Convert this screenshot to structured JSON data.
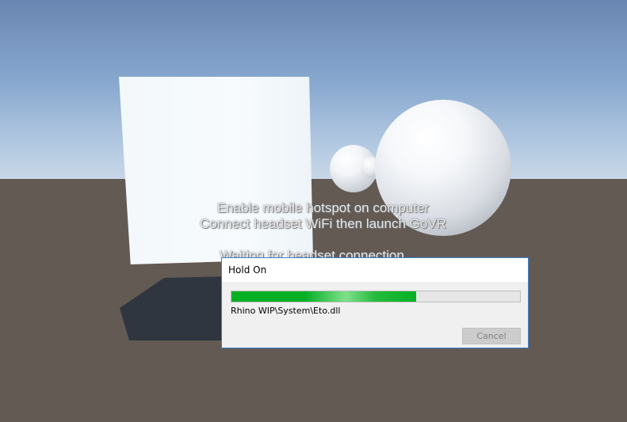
{
  "scene": {
    "instructions": [
      "Enable mobile hotspot on computer",
      "Connect headset WiFi then launch GoVR"
    ],
    "status": "Waiting for headset connection..."
  },
  "dialog": {
    "title": "Hold On",
    "progress_fraction": 0.64,
    "current_file": "Rhino WIP\\System\\Eto.dll",
    "cancel_label": "Cancel",
    "cancel_enabled": false
  },
  "colors": {
    "sky_top": "#6a86b2",
    "horizon": "#c8d7e6",
    "ground": "#625a53",
    "progress_green": "#06b025",
    "dialog_border": "#3e82d6"
  }
}
